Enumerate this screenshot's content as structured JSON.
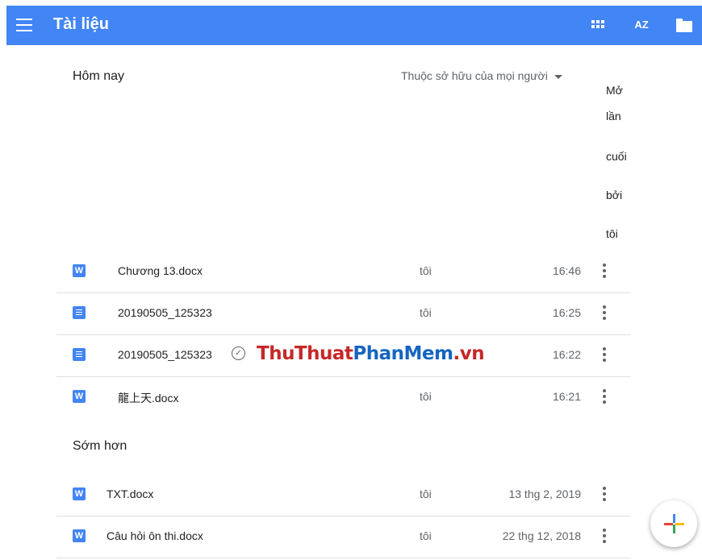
{
  "app": {
    "title": "Tài liệu"
  },
  "toolbar": {
    "sort_label": "AZ"
  },
  "sections": {
    "today": {
      "title": "Hôm nay",
      "owner_filter": "Thuộc sở hữu của mọi người",
      "sort_header": [
        "Mở",
        "lần",
        "cuối",
        "bởi",
        "tôi"
      ]
    },
    "earlier": {
      "title": "Sớm hơn"
    }
  },
  "files_today": [
    {
      "name": "Chương 13.docx",
      "owner": "tôi",
      "date": "16:46",
      "icon": "word-icon"
    },
    {
      "name": "20190505_125323",
      "owner": "tôi",
      "date": "16:25",
      "icon": "docs-icon"
    },
    {
      "name": "20190505_125323",
      "owner": "",
      "date": "16:22",
      "icon": "docs-icon",
      "offline": true
    },
    {
      "name": "龍上天.docx",
      "owner": "tôi",
      "date": "16:21",
      "icon": "word-icon"
    }
  ],
  "files_earlier": [
    {
      "name": "TXT.docx",
      "owner": "tôi",
      "date": "13 thg 2, 2019",
      "icon": "word-icon"
    },
    {
      "name": "Câu hỏi ôn thi.docx",
      "owner": "tôi",
      "date": "22 thg 12, 2018",
      "icon": "word-icon"
    }
  ],
  "watermark": {
    "part1": "ThuThuat",
    "part2": "PhanMem",
    "part3": ".vn"
  },
  "icons": {
    "word_letter": "W"
  },
  "colors": {
    "brand": "#4285f4",
    "fab_blue": "#4285f4",
    "fab_red": "#ea4335",
    "fab_yellow": "#fbbc04",
    "fab_green": "#34a853"
  }
}
